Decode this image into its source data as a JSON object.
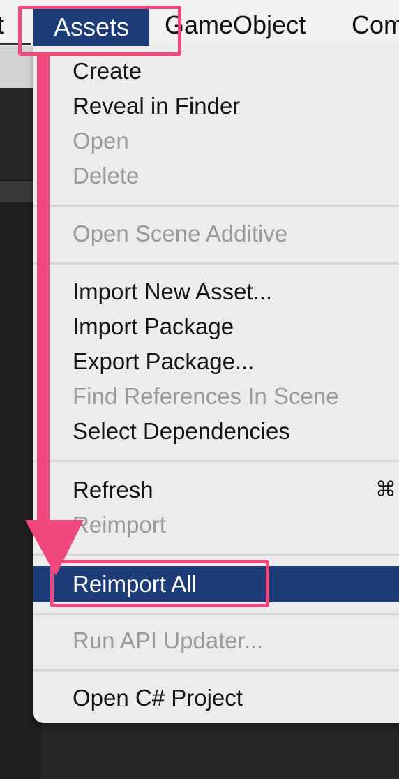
{
  "menubar": {
    "edit_fragment": "it",
    "assets": "Assets",
    "gameobject": "GameObject",
    "component_fragment": "Com"
  },
  "assets_menu": {
    "create": "Create",
    "reveal_in_finder": "Reveal in Finder",
    "open": "Open",
    "delete": "Delete",
    "open_scene_additive": "Open Scene Additive",
    "import_new_asset": "Import New Asset...",
    "import_package": "Import Package",
    "export_package": "Export Package...",
    "find_references_in_scene": "Find References In Scene",
    "select_dependencies": "Select Dependencies",
    "refresh": "Refresh",
    "refresh_shortcut": "⌘",
    "reimport": "Reimport",
    "reimport_all": "Reimport All",
    "run_api_updater": "Run API Updater...",
    "open_csharp_project": "Open C# Project"
  },
  "colors": {
    "highlight": "#1e3c78",
    "annotation": "#f0477c",
    "disabled_text": "#9a9a9a"
  }
}
